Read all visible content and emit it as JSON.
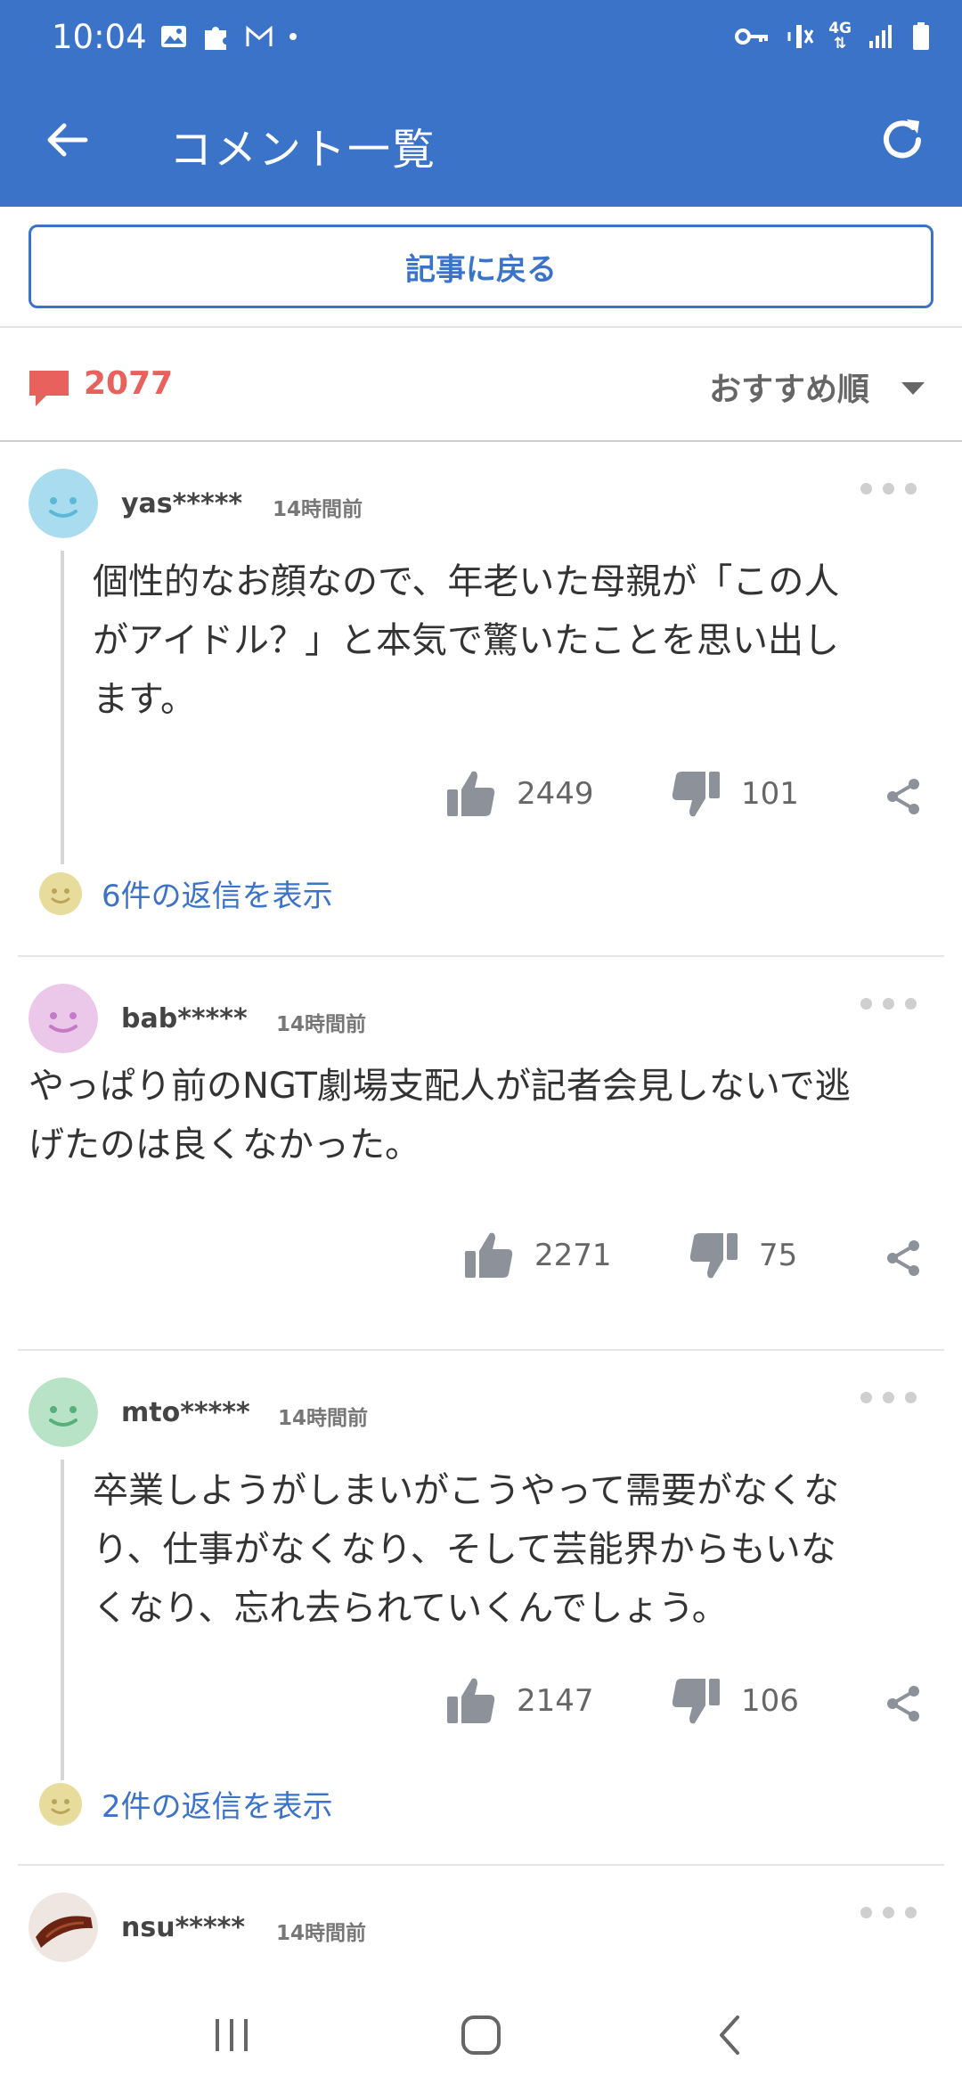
{
  "status": {
    "time": "10:04",
    "left_icons": [
      "image-icon",
      "puzzle-icon",
      "gmail-icon",
      "dot-icon"
    ],
    "right_icons": [
      "key-icon",
      "mute-icon",
      "4g-icon",
      "signal-icon",
      "battery-icon"
    ],
    "network_label": "4G"
  },
  "appbar": {
    "title": "コメント一覧"
  },
  "return_button": {
    "label": "記事に戻る"
  },
  "comments_summary": {
    "count": "2077",
    "sort_label": "おすすめ順"
  },
  "colors": {
    "brand": "#3b73c9",
    "count_red": "#e8615c",
    "reply_link": "#3b73c9"
  },
  "comments": [
    {
      "user": "yas*****",
      "time": "14時間前",
      "avatar_color": "#a8dcee",
      "avatar_face": "#5bb8d6",
      "lines": [
        "個性的なお顔なので、年老いた母親が「この人",
        "がアイドル？」と本気で驚いたことを思い出し",
        "ます。"
      ],
      "likes": "2449",
      "dislikes": "101",
      "replies": "6件の返信を表示"
    },
    {
      "user": "bab*****",
      "time": "14時間前",
      "avatar_color": "#ebc8ea",
      "avatar_face": "#c57ac5",
      "lines": [
        "やっぱり前のNGT劇場支配人が記者会見しないで逃",
        "げたのは良くなかった。"
      ],
      "likes": "2271",
      "dislikes": "75"
    },
    {
      "user": "mto*****",
      "time": "14時間前",
      "avatar_color": "#b8e3c6",
      "avatar_face": "#56b07a",
      "lines": [
        "卒業しようがしまいがこうやって需要がなくな",
        "り、仕事がなくなり、そして芸能界からもいな",
        "くなり、忘れ去られていくんでしょう。"
      ],
      "likes": "2147",
      "dislikes": "106",
      "replies": "2件の返信を表示"
    },
    {
      "user": "nsu*****",
      "time": "14時間前"
    }
  ]
}
